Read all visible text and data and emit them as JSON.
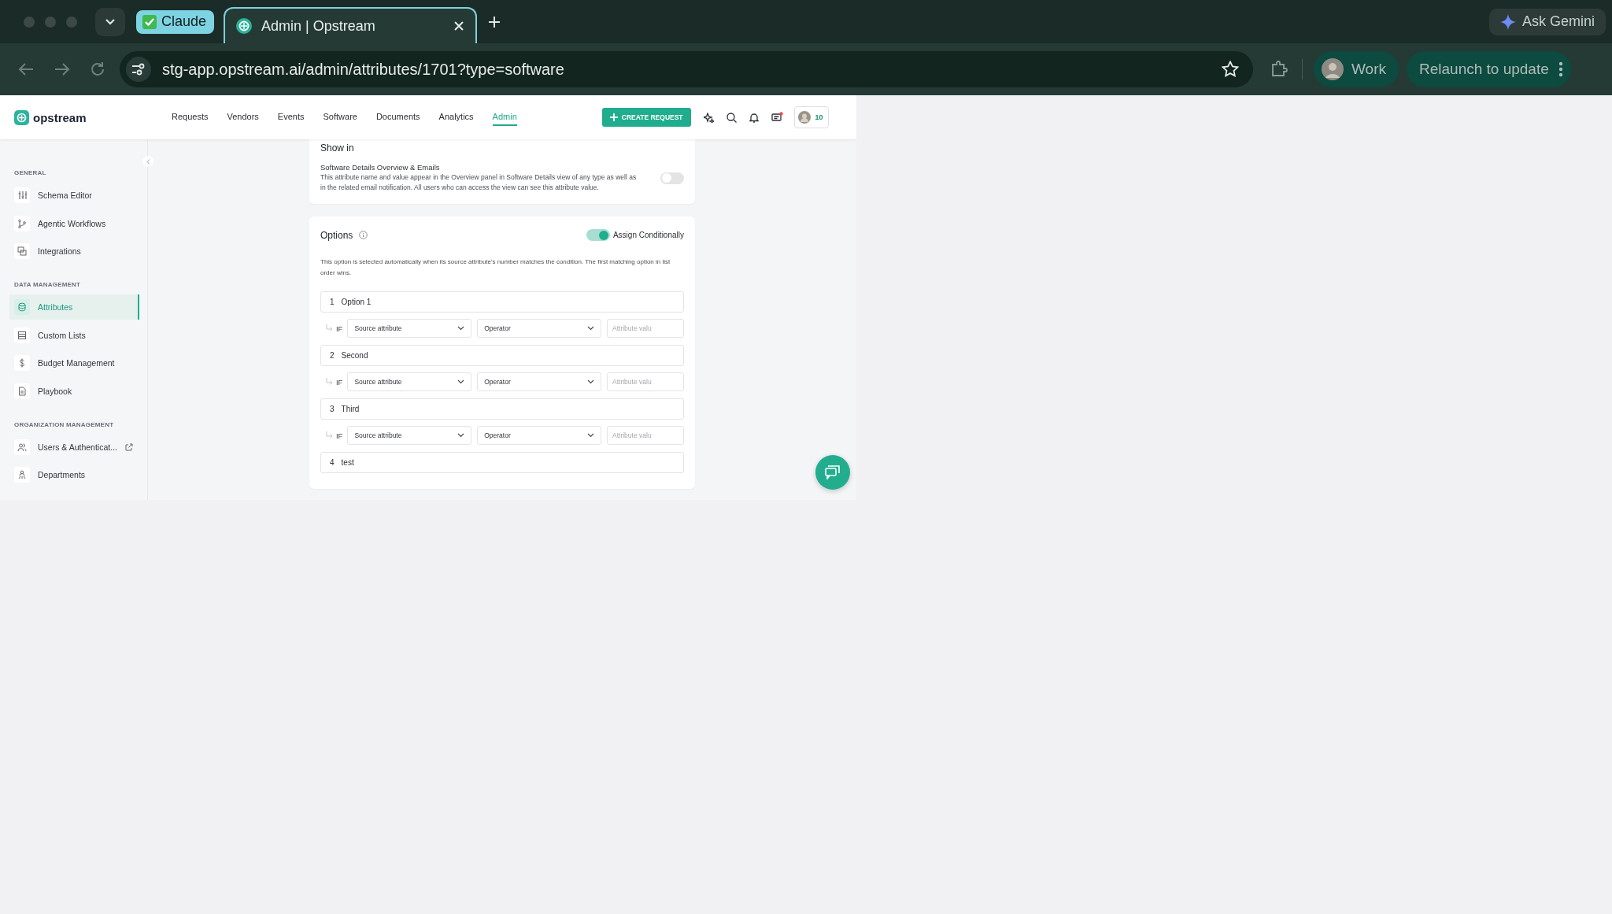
{
  "browser": {
    "tab_group": "Claude",
    "tabs": [
      {
        "title": "Admin | Opstream",
        "selected": true
      }
    ],
    "address": "stg-app.opstream.ai/admin/attributes/1701?type=software",
    "gemini": "Ask Gemini",
    "profile": "Work",
    "relaunch": "Relaunch to update"
  },
  "header": {
    "logo": "opstream",
    "nav": [
      {
        "label": "Requests",
        "selected": false
      },
      {
        "label": "Vendors",
        "selected": false
      },
      {
        "label": "Events",
        "selected": false
      },
      {
        "label": "Software",
        "selected": false
      },
      {
        "label": "Documents",
        "selected": false
      },
      {
        "label": "Analytics",
        "selected": false
      },
      {
        "label": "Admin",
        "selected": true
      }
    ],
    "create_button": "CREATE REQUEST",
    "badge": "10"
  },
  "sidebar": {
    "sections": [
      {
        "heading": "GENERAL",
        "items": [
          {
            "label": "Schema Editor",
            "kind": "sliders",
            "selected": false
          },
          {
            "label": "Agentic Workflows",
            "kind": "branch",
            "selected": false
          },
          {
            "label": "Integrations",
            "kind": "integrations",
            "selected": false
          }
        ]
      },
      {
        "heading": "DATA MANAGEMENT",
        "items": [
          {
            "label": "Attributes",
            "kind": "database",
            "selected": true
          },
          {
            "label": "Custom Lists",
            "kind": "list",
            "selected": false
          },
          {
            "label": "Budget Management",
            "kind": "dollar",
            "selected": false
          },
          {
            "label": "Playbook",
            "kind": "document",
            "selected": false
          }
        ]
      },
      {
        "heading": "ORGANIZATION MANAGEMENT",
        "items": [
          {
            "label": "Users & Authenticat...",
            "kind": "users",
            "selected": false,
            "external": true
          },
          {
            "label": "Departments",
            "kind": "org",
            "selected": false
          }
        ]
      }
    ]
  },
  "show_in": {
    "title": "Show in",
    "setting": {
      "title": "Software Details Overview & Emails",
      "description": "This attribute name and value appear in the Overview panel in Software Details view of any type as well as in the related email notification. All users who can access the view can see this attribute value.",
      "on": false
    }
  },
  "options": {
    "title": "Options",
    "assign_conditionally": {
      "label": "Assign Conditionally",
      "on": true
    },
    "description": "This option is selected automatically when its source attribute's number matches the condition. The first matching option in list order wins.",
    "items": [
      {
        "number": "1",
        "name": "Option 1",
        "condition": {
          "prefix": "IF",
          "source": "Source attribute",
          "operator": "Operator",
          "value_placeholder": "Attribute valu"
        }
      },
      {
        "number": "2",
        "name": "Second",
        "condition": {
          "prefix": "IF",
          "source": "Source attribute",
          "operator": "Operator",
          "value_placeholder": "Attribute valu"
        }
      },
      {
        "number": "3",
        "name": "Third",
        "condition": {
          "prefix": "IF",
          "source": "Source attribute",
          "operator": "Operator",
          "value_placeholder": "Attribute valu"
        }
      },
      {
        "number": "4",
        "name": "test"
      }
    ]
  }
}
